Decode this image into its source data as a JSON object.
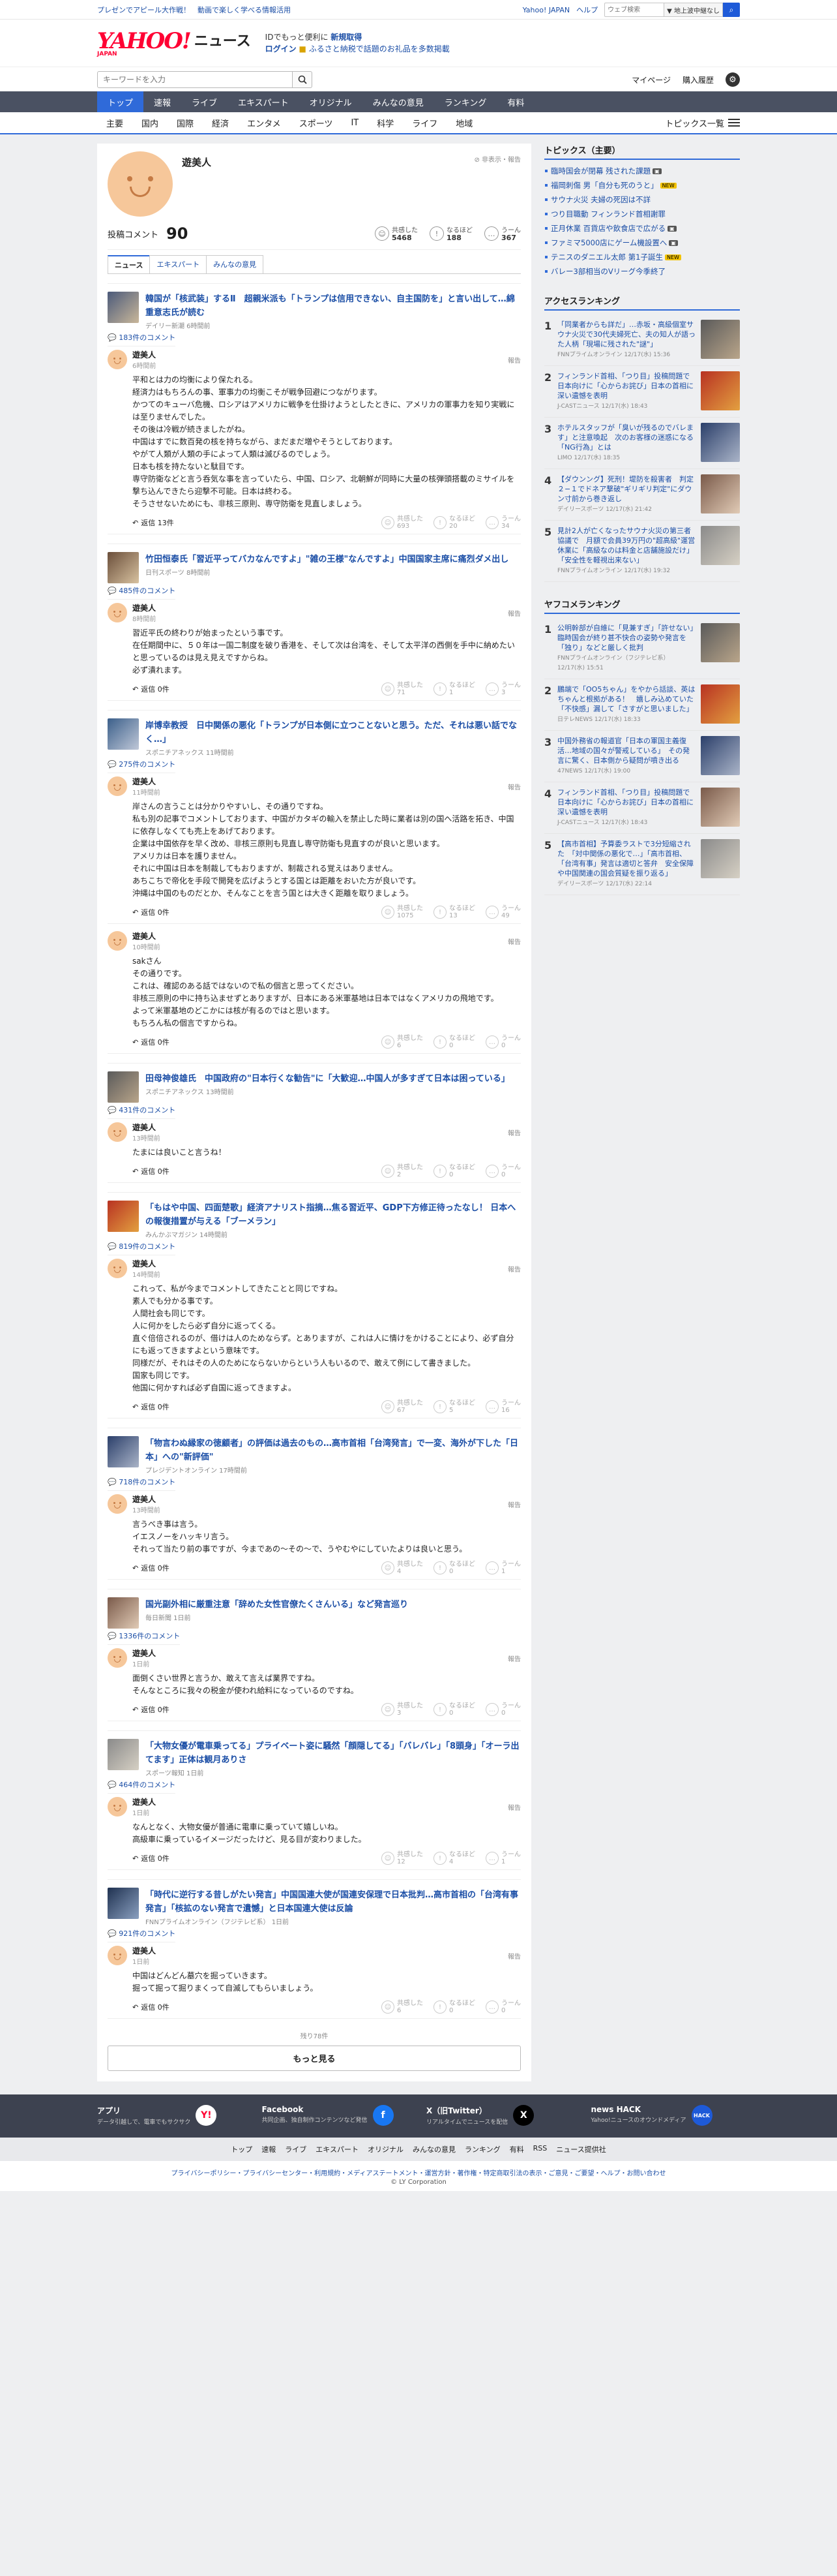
{
  "topbar": {
    "promo": "プレゼンでアピール大作戦！　動画で楽しく学べる情報活用",
    "links": [
      "Yahoo! JAPAN",
      "ヘルプ"
    ],
    "search_placeholder": "ウェブ検索",
    "scope": "▼ 地上波中継なし",
    "search_icon": "search-icon"
  },
  "header": {
    "logo": "YAHOO!",
    "logo_sub": "JAPAN",
    "service": "ニュース",
    "line1": "IDでもっと便利に",
    "line1b": "新規取得",
    "login": "ログイン",
    "line2": "ふるさと納税で話題のお礼品を多数掲載"
  },
  "search": {
    "placeholder": "キーワードを入力",
    "links": [
      "マイページ",
      "購入履歴"
    ]
  },
  "nav1": [
    "トップ",
    "速報",
    "ライブ",
    "エキスパート",
    "オリジナル",
    "みんなの意見",
    "ランキング",
    "有料"
  ],
  "nav2": [
    "主要",
    "国内",
    "国際",
    "経済",
    "エンタメ",
    "スポーツ",
    "IT",
    "科学",
    "ライフ",
    "地域"
  ],
  "nav2_list": "トピックス一覧",
  "profile": {
    "name": "遊美人",
    "report": "非表示・報告",
    "comment_label": "投稿コメント",
    "comment_count": "90",
    "reactions": [
      {
        "label": "共感した",
        "value": "5468"
      },
      {
        "label": "なるほど",
        "value": "188"
      },
      {
        "label": "うーん",
        "value": "367"
      }
    ],
    "tabs": [
      "ニュース",
      "エキスパート",
      "みんなの意見"
    ]
  },
  "common": {
    "reply": "返信",
    "report": "報告",
    "r1": "共感した",
    "r2": "なるほど",
    "r3": "うーん"
  },
  "articles": [
    {
      "title": "韓国が「核武装」するⅡ　超親米派も「トランプは信用できない、自主国防を」と言い出して…綿重意志氏が読む",
      "src": "デイリー新潮 6時間前",
      "count": "183件のコメント",
      "comments": [
        {
          "name": "遊美人",
          "time": "6時間前",
          "body": "平和とは力の均衡により保たれる。\n経済力はもちろんの事、軍事力の均衡こそが戦争回避につながります。\nかつてのキューバ危機、ロシアはアメリカに戦争を仕掛けようとしたときに、アメリカの軍事力を知り実戦には至りませんでした。\nその後は冷戦が続きましたがね。\n中国はすでに数百発の核を持ちながら、まだまだ増やそうとしております。\nやがて人類が人類の手によって人類は滅びるのでしょう。\n日本も核を持たないと駄目です。\n専守防衛などと言う呑気な事を言っていたら、中国、ロシア、北朝鮮が同時に大量の核弾頭搭載のミサイルを撃ち込んできたら迎撃不可能。日本は終わる。\nそうさせないためにも、非核三原則、専守防衛を見直しましょう。",
          "reply": "返信 13件",
          "v": [
            "693",
            "20",
            "34"
          ]
        }
      ]
    },
    {
      "title": "竹田恒泰氏「習近平ってバカなんですよ」\"雑の王様\"なんですよ」中国国家主席に痛烈ダメ出し",
      "src": "日刊スポーツ 8時間前",
      "count": "485件のコメント",
      "comments": [
        {
          "name": "遊美人",
          "time": "8時間前",
          "body": "習近平氏の終わりが始まったという事です。\n在任期間中に、５０年は一国二制度を破り香港を、そして次は台湾を、そして太平洋の西側を手中に納めたいと思っているのは見え見えですからね。\n必ず潰れます。",
          "reply": "返信 0件",
          "v": [
            "71",
            "1",
            "3"
          ]
        }
      ]
    },
    {
      "title": "岸博幸教授　日中関係の悪化「トランプが日本側に立つことないと思う。ただ、それは悪い話でなく…」",
      "src": "スポニチアネックス 11時間前",
      "count": "275件のコメント",
      "comments": [
        {
          "name": "遊美人",
          "time": "11時間前",
          "body": "岸さんの言うことは分かりやすいし、その通りですね。\n私も別の記事でコメントしております、中国がカタギの輸入を禁止した時に業者は別の国へ活路を拓き、中国に依存しなくても売上をあげております。\n企業は中国依存を早く改め、非核三原則も見直し専守防衛も見直すのが良いと思います。\nアメリカは日本を護りません。\nそれに中国は日本を制裁してもおりますが、制裁される覚えはありません。\nあちこちで帝化を手段で開発を広げようとする国とは距離をおいた方が良いです。\n沖縄は中国のものだとか、そんなことを言う国とは大きく距離を取りましょう。",
          "reply": "返信 0件",
          "v": [
            "1075",
            "13",
            "49"
          ]
        },
        {
          "name": "遊美人",
          "time": "10時間前",
          "body": "sakさん\nその通りです。\nこれは、確認のある話ではないので私の個言と思ってください。\n非核三原則の中に持ち込ませずとありますが、日本にある米軍基地は日本ではなくアメリカの飛地です。\nよって米軍基地のどこかには核が有るのではと思います。\nもちろん私の個言ですからね。",
          "reply": "返信 0件",
          "v": [
            "6",
            "0",
            "0"
          ]
        }
      ]
    },
    {
      "title": "田母神俊雄氏　中国政府の\"日本行くな勧告\"に「大歓迎…中国人が多すぎて日本は困っている」",
      "src": "スポニチアネックス 13時間前",
      "count": "431件のコメント",
      "comments": [
        {
          "name": "遊美人",
          "time": "13時間前",
          "body": "たまには良いこと言うね！",
          "reply": "返信 0件",
          "v": [
            "2",
            "0",
            "0"
          ]
        }
      ]
    },
    {
      "title": "「もはや中国、四面楚歌」経済アナリスト指摘…焦る習近平、GDP下方修正待ったなし！ 日本への報復措置が与える「ブーメラン」",
      "src": "みんかぶマガジン 14時間前",
      "count": "819件のコメント",
      "comments": [
        {
          "name": "遊美人",
          "time": "14時間前",
          "body": "これって、私が今までコメントしてきたことと同じですね。\n素人でも分かる事です。\n人間社会も同じです。\n人に何かをしたら必ず自分に返ってくる。\n直ぐ倍倍されるのが、借けは人のためならず。とありますが、これは人に情けをかけることにより、必ず自分にも返ってきますよという意味です。\n同様だが、それはその人のためにならないからという人もいるので、敢えて例にして書きました。\n国家も同じです。\n他国に何かすれば必ず自国に返ってきますよ。",
          "reply": "返信 0件",
          "v": [
            "67",
            "5",
            "16"
          ]
        }
      ]
    },
    {
      "title": "「物言わぬ縁家の徳顧者」の評価は過去のもの…高市首相「台湾発言」で一変、海外が下した「日本」への\"新評価\"",
      "src": "プレジデントオンライン 17時間前",
      "count": "718件のコメント",
      "comments": [
        {
          "name": "遊美人",
          "time": "13時間前",
          "body": "言うべき事は言う。\nイエスノーをハッキリ言う。\nそれって当たり前の事ですが、今まであの～その～で、うやむやにしていたよりは良いと思う。",
          "reply": "返信 0件",
          "v": [
            "4",
            "0",
            "1"
          ]
        }
      ]
    },
    {
      "title": "国光副外相に厳重注意「辞めた女性官僚たくさんいる」など発言巡り",
      "src": "毎日新聞 1日前",
      "count": "1336件のコメント",
      "comments": [
        {
          "name": "遊美人",
          "time": "1日前",
          "body": "面倒くさい世界と言うか、敢えて言えば業界ですね。\nそんなところに我々の税金が使われ給料になっているのですね。",
          "reply": "返信 0件",
          "v": [
            "3",
            "0",
            "0"
          ]
        }
      ]
    },
    {
      "title": "「大物女優が電車乗ってる」プライベート姿に騒然「顔隠してる」「バレバレ」「8頭身」「オーラ出てます」正体は観月ありさ",
      "src": "スポーツ報知 1日前",
      "count": "464件のコメント",
      "comments": [
        {
          "name": "遊美人",
          "time": "1日前",
          "body": "なんとなく、大物女優が普通に電車に乗っていて嬉しいね。\n高級車に乗っているイメージだったけど、見る目が変わりました。",
          "reply": "返信 0件",
          "v": [
            "12",
            "4",
            "1"
          ]
        }
      ]
    },
    {
      "title": "「時代に逆行する昔しがたい発言」中国国連大使が国連安保理で日本批判…高市首相の「台湾有事発言」「核拡のない発言で遺憾」と日本国連大使は反論",
      "src": "FNNプライムオンライン（フジテレビ系） 1日前",
      "count": "921件のコメント",
      "comments": [
        {
          "name": "遊美人",
          "time": "1日前",
          "body": "中国はどんどん墓穴を掘っていきます。\n掘って掘って掘りまくって自滅してもらいましょう。",
          "reply": "返信 0件",
          "v": [
            "6",
            "0",
            "0"
          ]
        }
      ]
    }
  ],
  "pager": "残り78件",
  "more": "もっと見る",
  "sidebar": {
    "topics_title": "トピックス（主要）",
    "topics": [
      {
        "t": "臨時国会が閉幕 残された課題",
        "tag": "img"
      },
      {
        "t": "福岡刺傷 男「自分も死のうと」",
        "tag": "new"
      },
      {
        "t": "サウナ火災 夫婦の死因は不詳",
        "tag": ""
      },
      {
        "t": "つり目職動 フィンランド首相謝罪",
        "tag": ""
      },
      {
        "t": "正月休業 百貨店や飲食店で広がる",
        "tag": "img"
      },
      {
        "t": "ファミマ5000店にゲーム機設置へ",
        "tag": "img"
      },
      {
        "t": "テニスのダニエル太郎 第1子誕生",
        "tag": "new"
      },
      {
        "t": "バレー3部相当のVリーグ今季終了",
        "tag": ""
      }
    ],
    "access_title": "アクセスランキング",
    "access": [
      {
        "t": "「同業者からも詳だ」…赤坂・高級個室サウナ火災で30代夫婦死亡、夫の知人が語った人柄「現場に残された\"謎\"」",
        "s": "FNNプライムオンライン 12/17(水) 15:36"
      },
      {
        "t": "フィンランド首相、「つり目」投稿問題で日本向けに「心からお詫び」日本の首相に深い遺憾を表明",
        "s": "J-CASTニュース 12/17(水) 18:43"
      },
      {
        "t": "ホテルスタッフが「臭いが残るのでバレます」と注意喚起　次のお客様の迷惑になる「NG行為」とは",
        "s": "LIMO 12/17(水) 18:35"
      },
      {
        "t": "【ダウンング】死刑！堤防を殺害者　判定２−１でドネア撃破\"ギリギリ判定\"にダウン寸前から巻き返し",
        "s": "デイリースポーツ 12/17(水) 21:42"
      },
      {
        "t": "見計2人が亡くなったサウナ火災の第三者協議で　月額で会員39万円の\"超高級\"運営休業に「高級なのは料金と店舗施設だけ」「安全性を軽視出来ない」",
        "s": "FNNプライムオンライン 12/17(水) 19:32"
      }
    ],
    "comment_title": "ヤフコメランキング",
    "comment_rank": [
      {
        "t": "公明幹部が自維に「見兼すぎ」「許せない」　臨時国会が終り甚不快合の姿勢や発言を「独り」などと厳しく批判",
        "s": "FNNプライムオンライン（フジテレビ系） 12/17(水) 15:51"
      },
      {
        "t": "鵬端で「OO5ちゃん」をやから話談、英はちゃんと根拠がある！　嬉しみ込めていた「不快感」漏して「さすがと思いました」",
        "s": "日テレNEWS 12/17(水) 18:33"
      },
      {
        "t": "中国外務省の報道官「日本の軍国主義復活…地域の国々が警戒している」　その発言に驚く、日本側から疑問が噴き出る",
        "s": "47NEWS 12/17(水) 19:00"
      },
      {
        "t": "フィンランド首相、「つり目」投稿問題で日本向けに「心からお詫び」日本の首相に深い遺憾を表明",
        "s": "J-CASTニュース 12/17(水) 18:43"
      },
      {
        "t": "【高市首相】予算委ラストで3分短縮された　「対中関係の悪化で…」「高市首相、「台湾有事」発言は適切と答弁　安全保障や中国関連の国会質疑を振り返る」",
        "s": "デイリースポーツ 12/17(水) 22:14"
      }
    ]
  },
  "footer": {
    "apps": [
      {
        "name": "アプリ",
        "desc": "データ引越しで、電車でもサクサク",
        "icon": "app-icon",
        "symbol": "Y!"
      },
      {
        "name": "Facebook",
        "desc": "共同企画、独自制作コンテンツなど発信",
        "icon": "facebook-icon",
        "symbol": "f"
      },
      {
        "name": "X（旧Twitter）",
        "desc": "リアルタイムでニュースを配信",
        "icon": "x-icon",
        "symbol": "X"
      },
      {
        "name": "news HACK",
        "desc": "Yahoo!ニュースのオウンドメディア",
        "icon": "newshack-icon",
        "symbol": "HACK"
      }
    ],
    "links": [
      "トップ",
      "速報",
      "ライブ",
      "エキスパート",
      "オリジナル",
      "みんなの意見",
      "ランキング",
      "有料",
      "RSS",
      "ニュース提供社"
    ],
    "legal": "プライバシーポリシー・プライバシーセンター・利用規約・メディアステートメント・運営方針・著作権・特定商取引法の表示・ご意見・ご要望・ヘルプ・お問い合わせ",
    "copy": "© LY Corporation"
  }
}
